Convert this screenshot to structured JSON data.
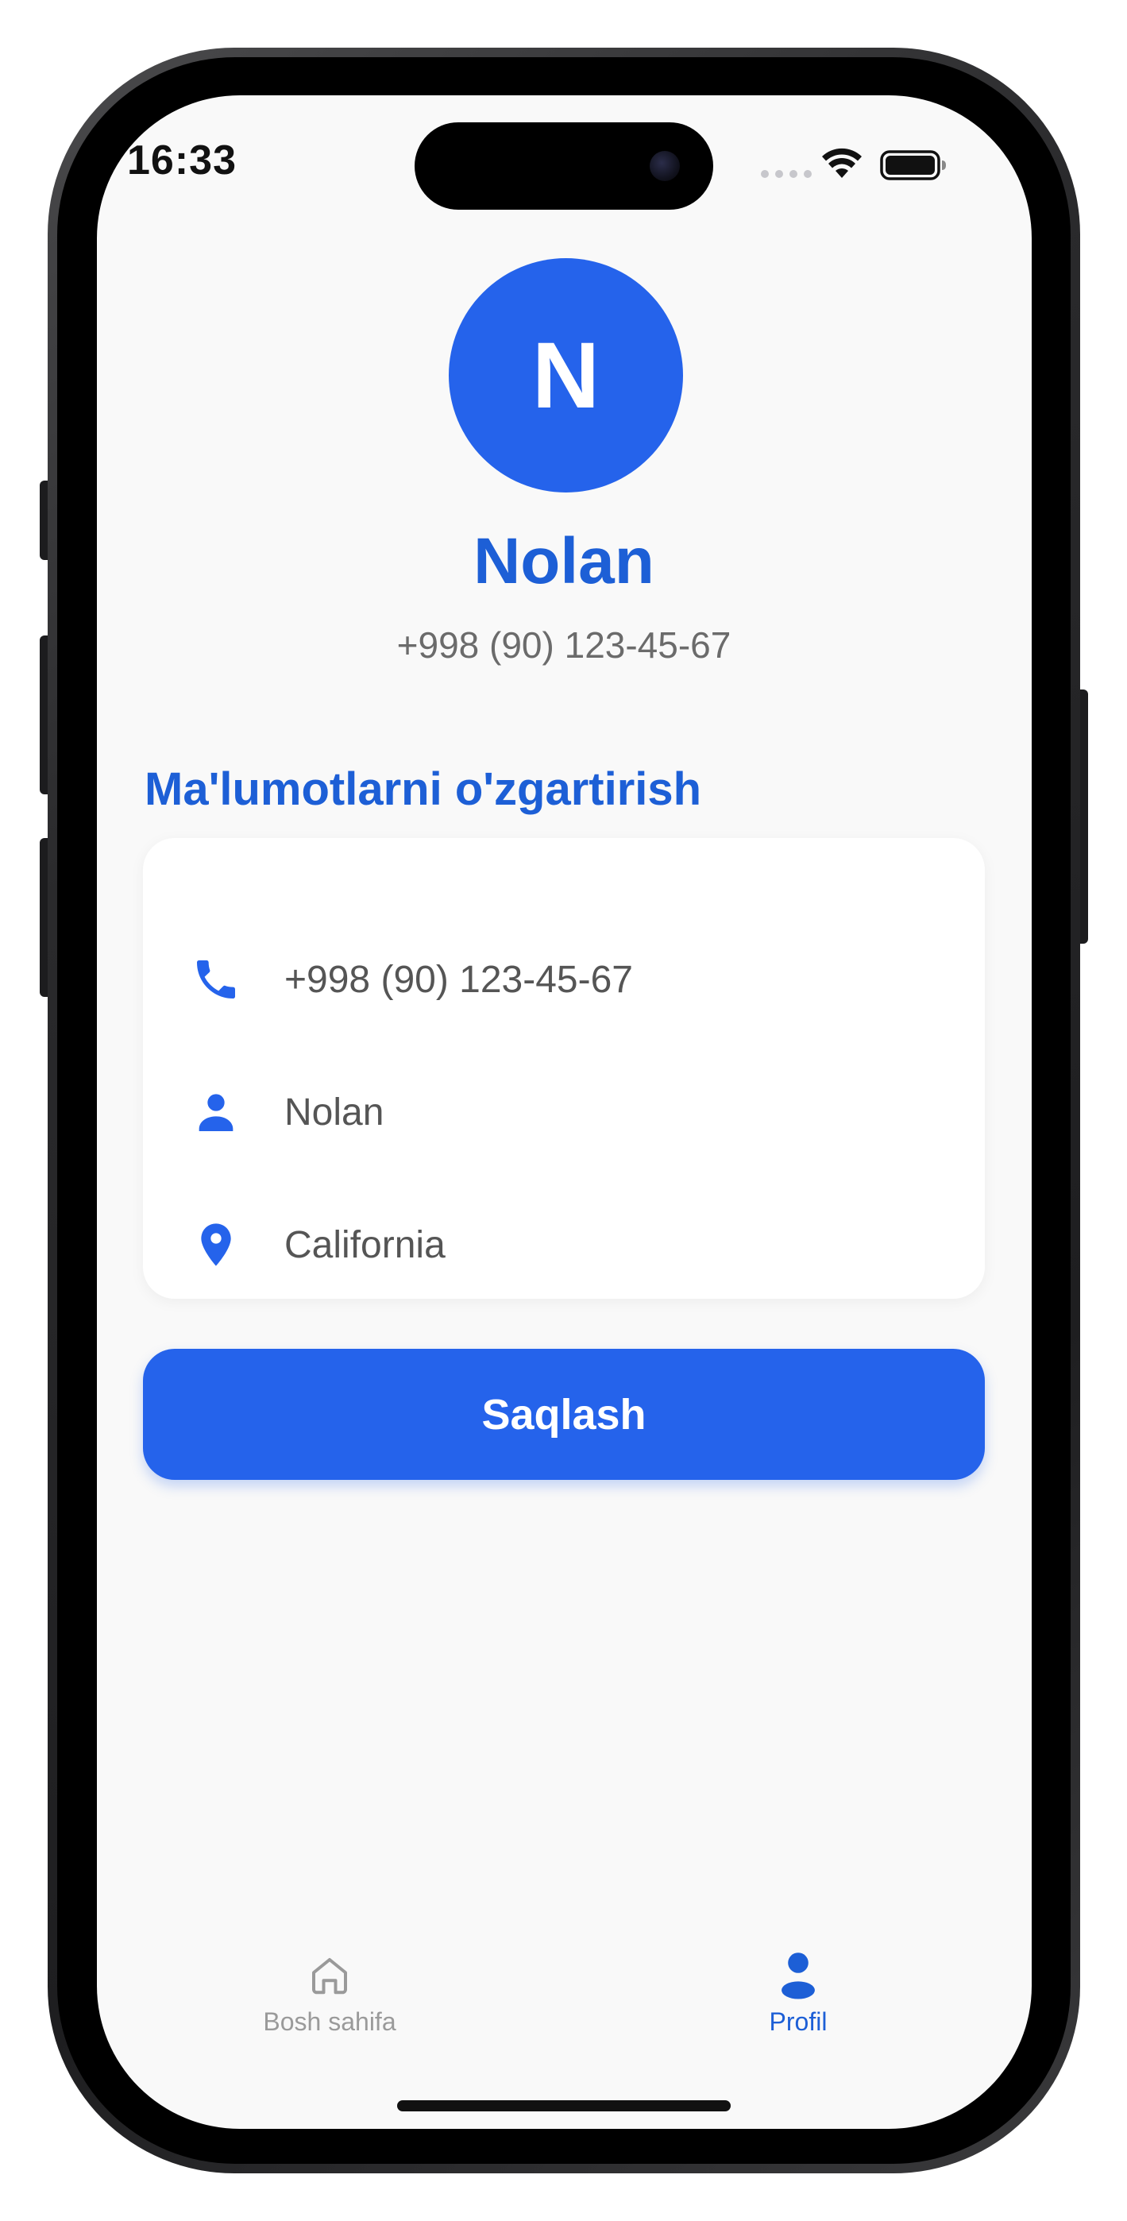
{
  "status_bar": {
    "time": "16:33"
  },
  "profile": {
    "avatar_initial": "N",
    "name": "Nolan",
    "phone": "+998 (90) 123-45-67"
  },
  "edit_section": {
    "title": "Ma'lumotlarni o'zgartirish",
    "fields": [
      {
        "icon": "phone-icon",
        "value": "+998 (90) 123-45-67"
      },
      {
        "icon": "person-icon",
        "value": "Nolan"
      },
      {
        "icon": "location-pin-icon",
        "value": "California"
      }
    ],
    "save_label": "Saqlash"
  },
  "bottom_nav": {
    "items": [
      {
        "icon": "home-icon",
        "label": "Bosh sahifa",
        "active": false
      },
      {
        "icon": "person-icon",
        "label": "Profil",
        "active": true
      }
    ]
  },
  "colors": {
    "accent": "#2563eb",
    "accent_text": "#1d5fd6",
    "screen_background": "#f9f9f9",
    "muted_text": "#6b6b6b"
  }
}
